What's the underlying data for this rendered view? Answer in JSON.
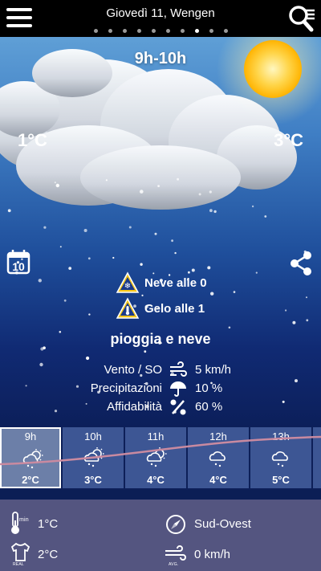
{
  "header": {
    "title": "Giovedì 11, Wengen",
    "page_dots": 10,
    "active_dot": 7
  },
  "forecast": {
    "time_range": "9h-10h",
    "temp_min": "1°C",
    "temp_max": "3°C",
    "alerts": [
      {
        "icon": "snow-warning-icon",
        "text": "Neve alle 0"
      },
      {
        "icon": "frost-warning-icon",
        "text": "Gelo alle 1"
      }
    ],
    "condition": "pioggia e neve",
    "stats": [
      {
        "label": "Vento / SO",
        "icon": "wind-icon",
        "value": "5 km/h"
      },
      {
        "label": "Precipitazioni",
        "icon": "umbrella-icon",
        "value": "10 %"
      },
      {
        "label": "Affidabilità",
        "icon": "percent-icon",
        "value": "60 %"
      }
    ]
  },
  "hourly": [
    {
      "hour": "9h",
      "temp": "2°C",
      "icon": "cloud-snow-sun-icon",
      "selected": true
    },
    {
      "hour": "10h",
      "temp": "3°C",
      "icon": "cloud-snow-sun-icon",
      "selected": false
    },
    {
      "hour": "11h",
      "temp": "4°C",
      "icon": "cloud-snow-sun-icon",
      "selected": false
    },
    {
      "hour": "12h",
      "temp": "4°C",
      "icon": "cloud-snow-icon",
      "selected": false
    },
    {
      "hour": "13h",
      "temp": "5°C",
      "icon": "cloud-snow-icon",
      "selected": false
    }
  ],
  "details": {
    "min_label": "min",
    "min_temp": "1°C",
    "real_label": "REAL",
    "real_temp": "2°C",
    "wind_direction": "Sud-Ovest",
    "avg_label": "AVG.",
    "avg_wind": "0 km/h"
  },
  "colors": {
    "topbar": "#000000",
    "hour_card": "#3d5694",
    "hour_card_selected": "#6c7fa8",
    "trend_line": "#c98aa0",
    "bottom_panel": "#545580",
    "sun": "#ffd54a"
  }
}
